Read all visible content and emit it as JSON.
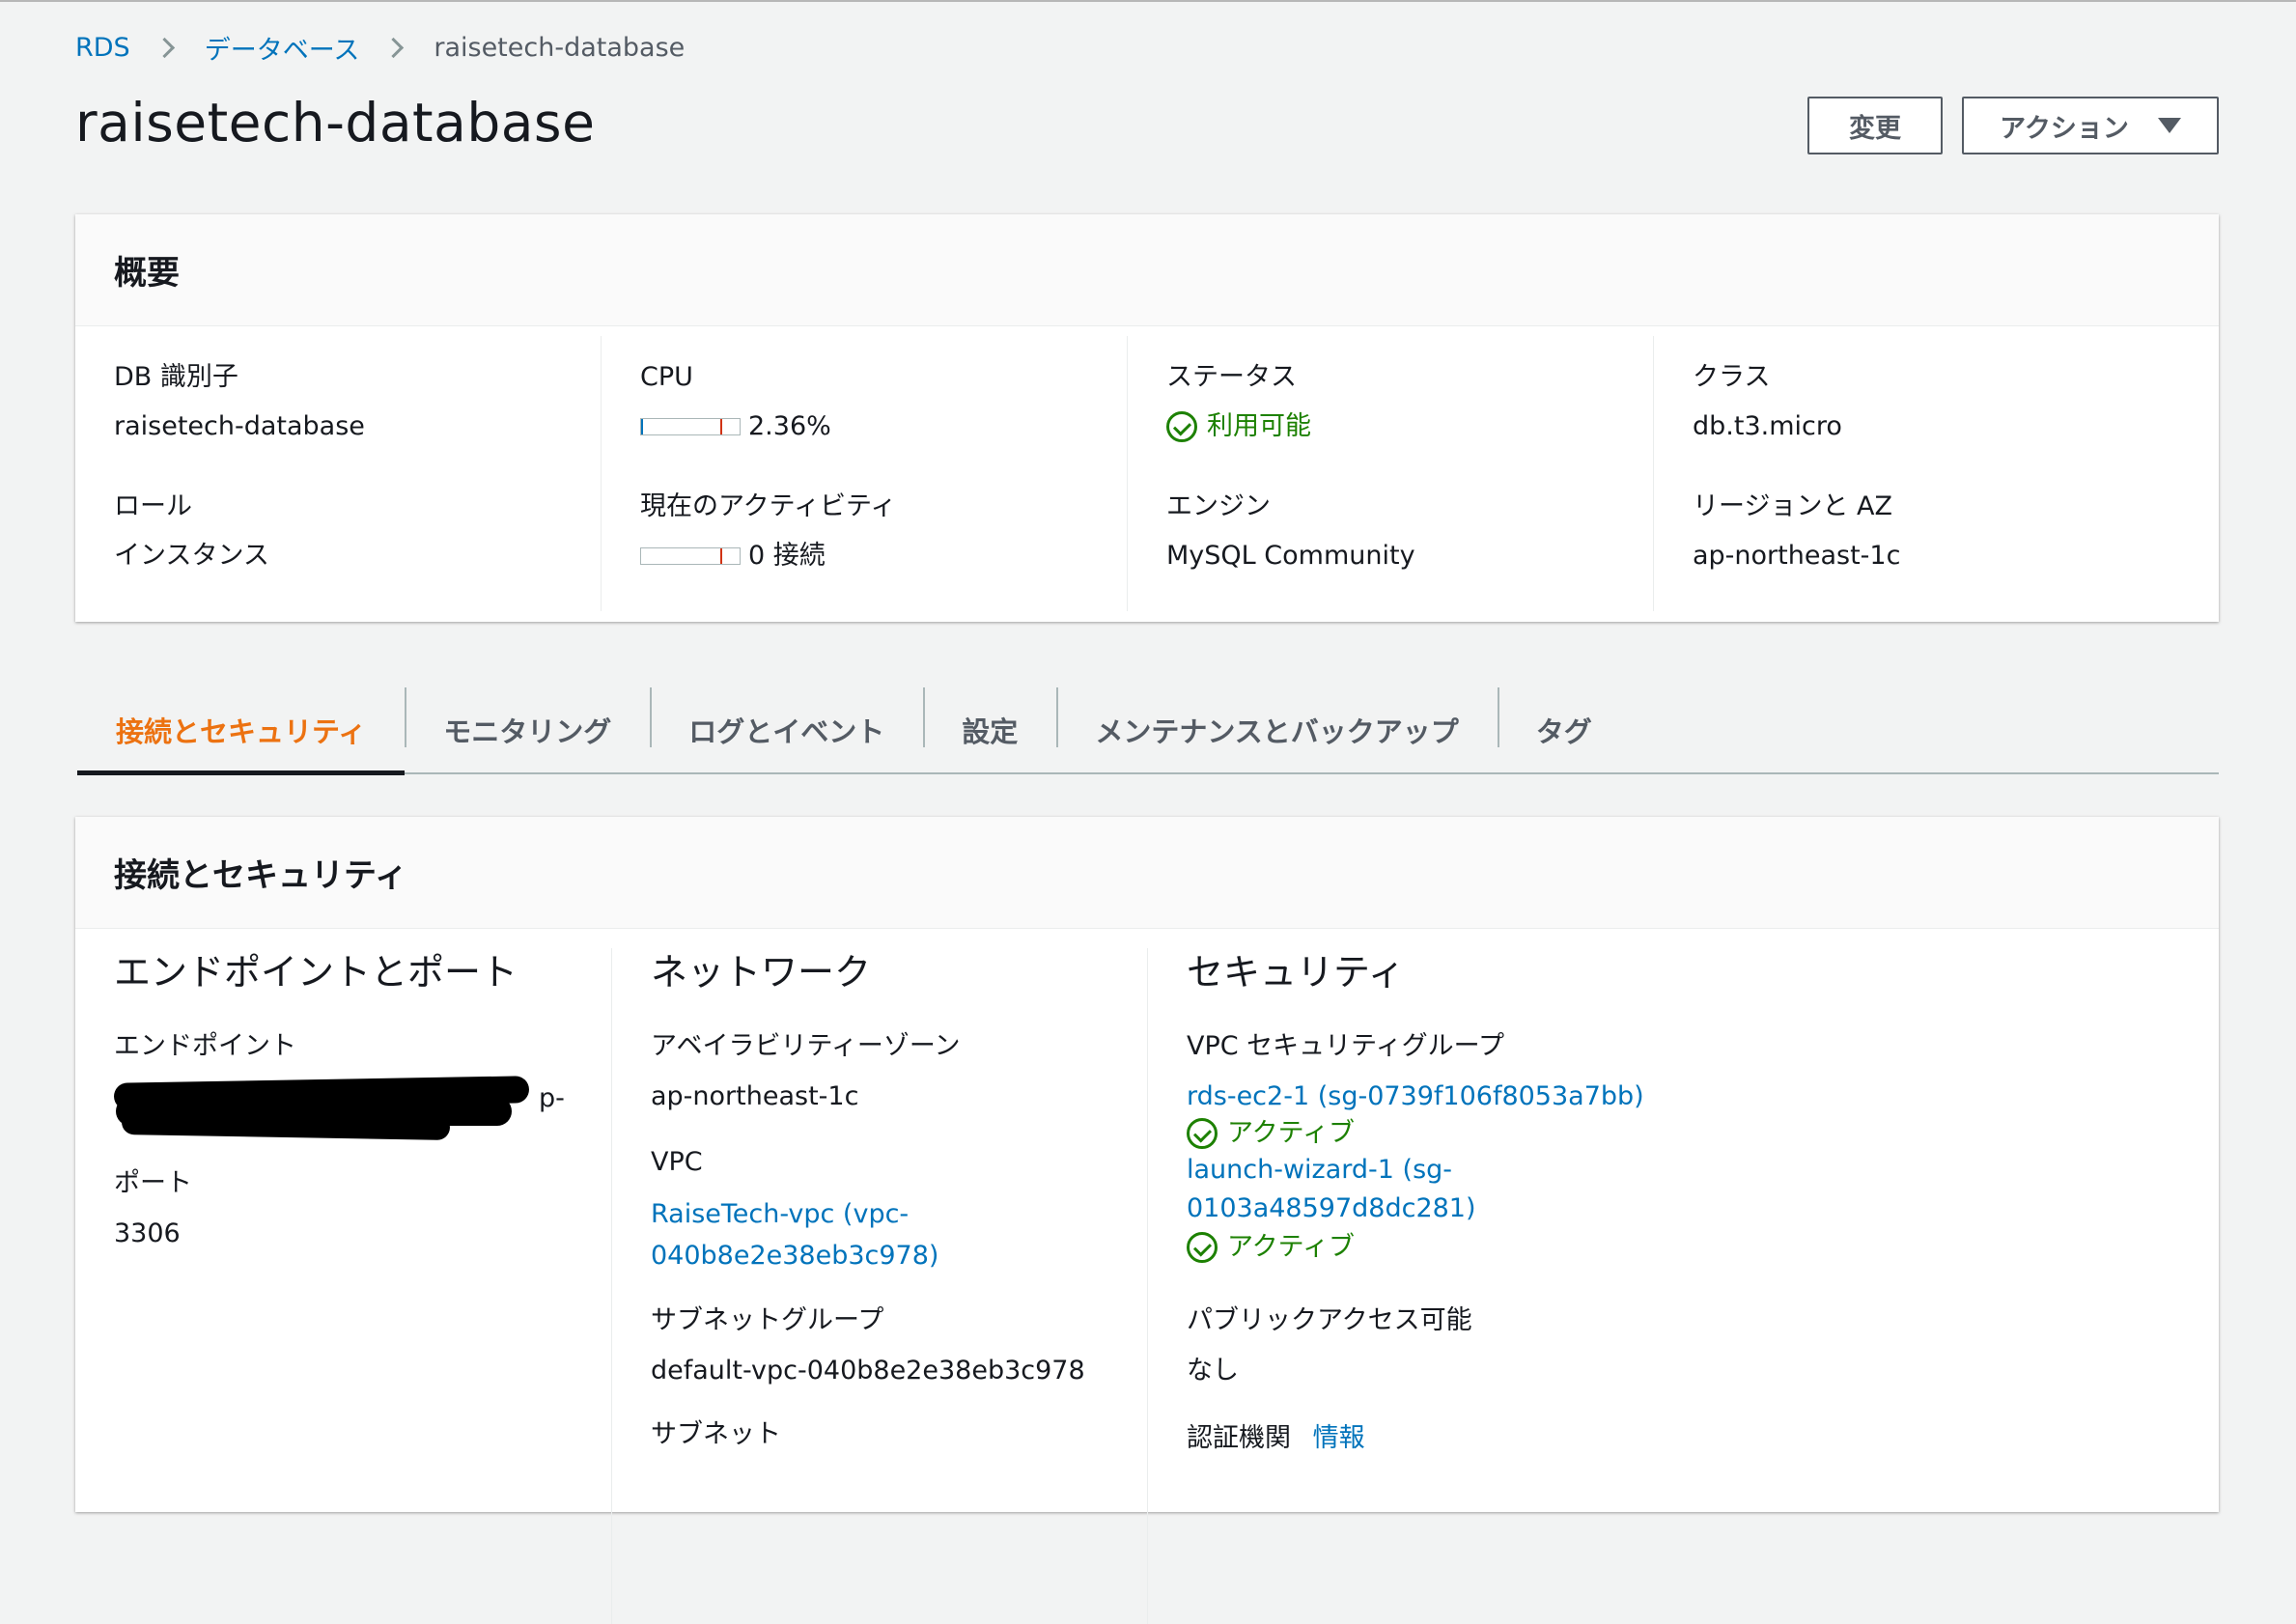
{
  "breadcrumb": {
    "root": "RDS",
    "section": "データベース",
    "current": "raisetech-database"
  },
  "title": "raisetech-database",
  "buttons": {
    "modify": "変更",
    "actions": "アクション"
  },
  "summary": {
    "header": "概要",
    "db_id_label": "DB 識別子",
    "db_id_value": "raisetech-database",
    "role_label": "ロール",
    "role_value": "インスタンス",
    "cpu_label": "CPU",
    "cpu_value": "2.36%",
    "cpu_fraction": 0.0236,
    "activity_label": "現在のアクティビティ",
    "activity_value": "0 接続",
    "status_label": "ステータス",
    "status_value": "利用可能",
    "engine_label": "エンジン",
    "engine_value": "MySQL Community",
    "class_label": "クラス",
    "class_value": "db.t3.micro",
    "region_label": "リージョンと AZ",
    "region_value": "ap-northeast-1c"
  },
  "tabs": [
    {
      "label": "接続とセキュリティ",
      "active": true
    },
    {
      "label": "モニタリング"
    },
    {
      "label": "ログとイベント"
    },
    {
      "label": "設定"
    },
    {
      "label": "メンテナンスとバックアップ"
    },
    {
      "label": "タグ"
    }
  ],
  "connectivity": {
    "header": "接続とセキュリティ",
    "endpoint_section": {
      "title": "エンドポイントとポート",
      "endpoint_label": "エンドポイント",
      "endpoint_tail": "p-",
      "port_label": "ポート",
      "port_value": "3306"
    },
    "network_section": {
      "title": "ネットワーク",
      "az_label": "アベイラビリティーゾーン",
      "az_value": "ap-northeast-1c",
      "vpc_label": "VPC",
      "vpc_value_line1": "RaiseTech-vpc (vpc-",
      "vpc_value_line2": "040b8e2e38eb3c978)",
      "subnet_group_label": "サブネットグループ",
      "subnet_group_value": "default-vpc-040b8e2e38eb3c978",
      "subnet_label": "サブネット"
    },
    "security_section": {
      "title": "セキュリティ",
      "sg_label": "VPC セキュリティグループ",
      "sg1": "rds-ec2-1 (sg-0739f106f8053a7bb)",
      "sg1_status": "アクティブ",
      "sg2_line1": "launch-wizard-1 (sg-",
      "sg2_line2": "0103a48597d8dc281)",
      "sg2_status": "アクティブ",
      "public_label": "パブリックアクセス可能",
      "public_value": "なし",
      "ca_label": "認証機関",
      "ca_info": "情報"
    }
  },
  "colors": {
    "link": "#0073bb",
    "active_tab": "#ec7211",
    "status_ok": "#1d8102",
    "background": "#f2f3f3"
  },
  "icons": [
    "chevron-right-icon",
    "caret-down-icon",
    "status-check-icon"
  ]
}
